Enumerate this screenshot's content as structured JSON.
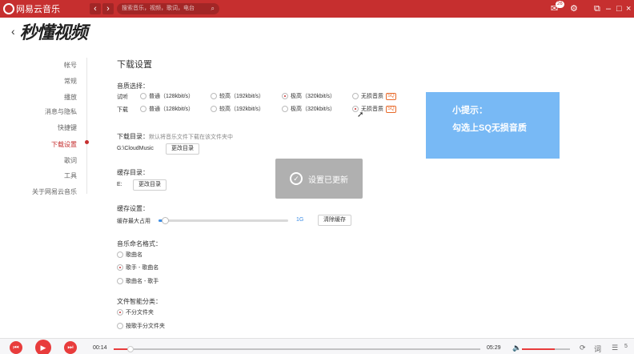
{
  "app": {
    "name": "网易云音乐",
    "search_placeholder": "搜索音乐，视频，歌词，电台",
    "notification_count": "26"
  },
  "watermark": {
    "text": "秒懂视频"
  },
  "sidebar": {
    "items": [
      {
        "label": "帐号",
        "active": false
      },
      {
        "label": "常规",
        "active": false
      },
      {
        "label": "播放",
        "active": false
      },
      {
        "label": "消息与隐私",
        "active": false
      },
      {
        "label": "快捷键",
        "active": false
      },
      {
        "label": "下载设置",
        "active": true
      },
      {
        "label": "歌词",
        "active": false
      },
      {
        "label": "工具",
        "active": false
      },
      {
        "label": "关于网易云音乐",
        "active": false
      }
    ]
  },
  "download_settings": {
    "title": "下载设置",
    "quality": {
      "label": "音质选择：",
      "rows": [
        {
          "label": "试听",
          "options": [
            "普通（128kbit/s）",
            "较高（192kbit/s）",
            "极高（320kbit/s）",
            "无损音质"
          ],
          "selected_index": 2
        },
        {
          "label": "下载",
          "options": [
            "普通（128kbit/s）",
            "较高（192kbit/s）",
            "极高（320kbit/s）",
            "无损音质"
          ],
          "selected_index": 3
        }
      ],
      "sq_badge": "SQ"
    },
    "download_dir": {
      "label": "下载目录：",
      "hint": "默认将音乐文件下载在该文件夹中",
      "path": "G:\\CloudMusic",
      "button": "更改目录"
    },
    "cache_dir": {
      "label": "缓存目录：",
      "path": "E:",
      "button": "更改目录"
    },
    "cache_settings": {
      "label": "缓存设置：",
      "max_label": "缓存最大占用",
      "value": "1G",
      "level_fraction": 0.05,
      "button": "清除缓存"
    },
    "naming": {
      "label": "音乐命名格式：",
      "options": [
        "歌曲名",
        "歌手 - 歌曲名",
        "歌曲名 - 歌手"
      ],
      "selected_index": 1
    },
    "smart_folders": {
      "label": "文件智能分类：",
      "options": [
        "不分文件夹",
        "按歌手分文件夹"
      ],
      "selected_index": 0
    }
  },
  "toast": {
    "text": "设置已更新"
  },
  "tip": {
    "title": "小提示：",
    "body": "勾选上SQ无损音质"
  },
  "player": {
    "current_time": "00:14",
    "total_time": "05:29",
    "progress_fraction": 0.045,
    "volume_fraction": 0.68,
    "playlist_count": "5"
  },
  "colors": {
    "brand": "#c62f2f",
    "tip_bg": "#78b9f5",
    "accent_blue": "#3d8ee6"
  }
}
